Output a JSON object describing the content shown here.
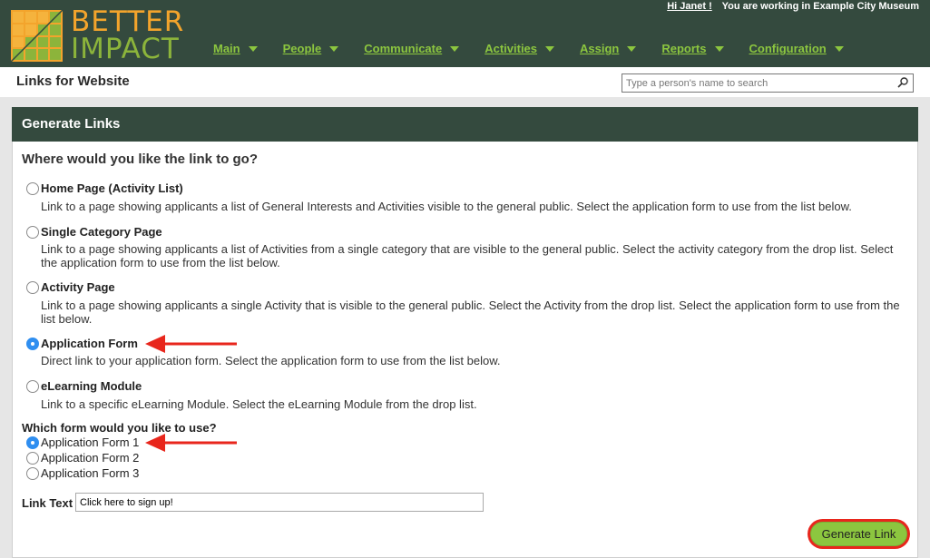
{
  "header": {
    "logo_line1": "BETTER",
    "logo_line2": "IMPACT",
    "greeting": "Hi Janet !",
    "working_in": "You are working in Example City Museum",
    "nav": [
      {
        "label": "Main"
      },
      {
        "label": "People"
      },
      {
        "label": "Communicate"
      },
      {
        "label": "Activities"
      },
      {
        "label": "Assign"
      },
      {
        "label": "Reports"
      },
      {
        "label": "Configuration"
      }
    ]
  },
  "subheader": {
    "title": "Links for Website",
    "search_placeholder": "Type a person's name to search"
  },
  "panel": {
    "title": "Generate Links",
    "question": "Where would you like the link to go?",
    "options": [
      {
        "label": "Home Page (Activity List)",
        "desc": "Link to a page showing applicants a list of General Interests and Activities visible to the general public. Select the application form to use from the list below.",
        "selected": false
      },
      {
        "label": "Single Category Page",
        "desc": "Link to a page showing applicants a list of Activities from a single category that are visible to the general public. Select the activity category from the drop list. Select the application form to use from the list below.",
        "selected": false
      },
      {
        "label": "Activity Page",
        "desc": "Link to a page showing applicants a single Activity that is visible to the general public. Select the Activity from the drop list. Select the application form to use from the list below.",
        "selected": false
      },
      {
        "label": "Application Form",
        "desc": "Direct link to your application form. Select the application form to use from the list below.",
        "selected": true
      },
      {
        "label": "eLearning Module",
        "desc": "Link to a specific eLearning Module. Select the eLearning Module from the drop list.",
        "selected": false
      }
    ],
    "form_question": "Which form would you like to use?",
    "forms": [
      {
        "label": "Application Form 1",
        "selected": true
      },
      {
        "label": "Application Form 2",
        "selected": false
      },
      {
        "label": "Application Form 3",
        "selected": false
      }
    ],
    "link_text_label": "Link Text",
    "link_text_value": "Click here to sign up!",
    "generate_button": "Generate Link"
  },
  "colors": {
    "header_bg": "#344a3e",
    "logo_orange": "#f3a42c",
    "logo_green": "#8cb43b",
    "nav_green": "#8cc63f",
    "radio_selected": "#2f8ef0",
    "annotation_red": "#e8261c"
  }
}
